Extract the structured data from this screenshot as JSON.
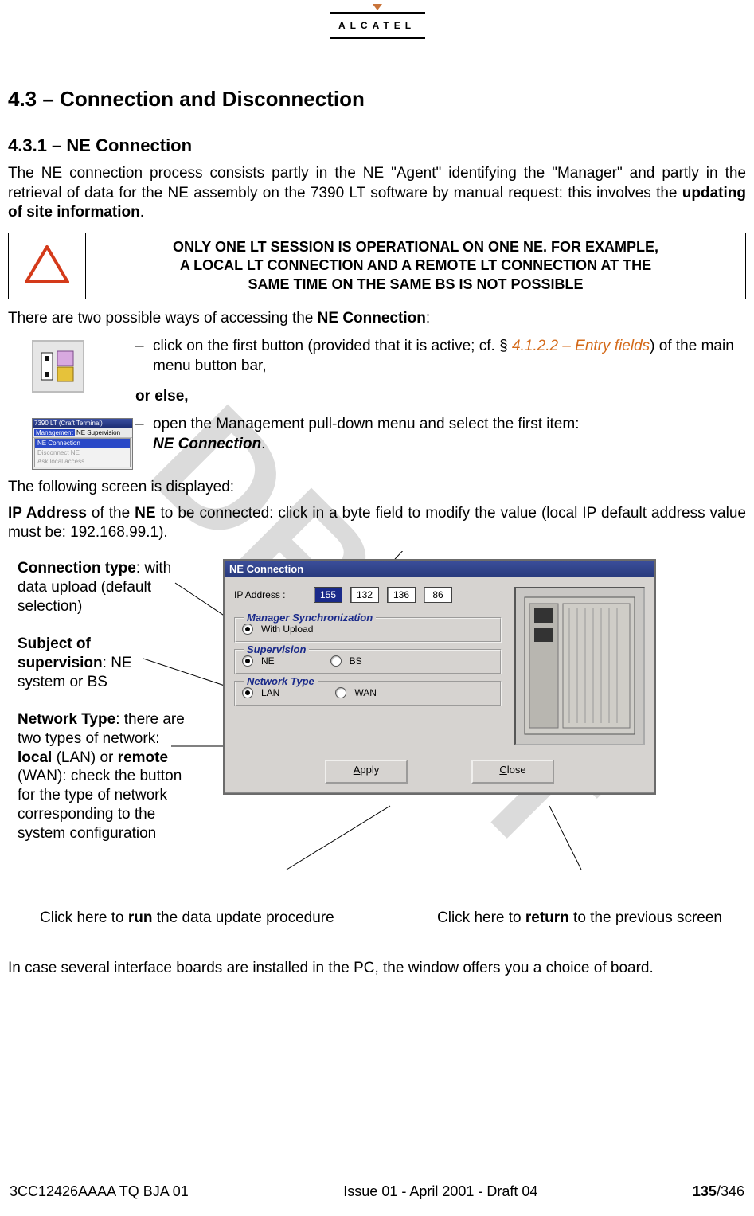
{
  "brand": "ALCATEL",
  "watermark": "DRAFT",
  "h1": "4.3 – Connection and Disconnection",
  "h2": "4.3.1 –  NE Connection",
  "p1_a": "The NE connection process consists partly in the NE \"Agent\" identifying the \"Manager\" and partly in the retrieval of data for the NE assembly on the 7390 LT software by manual request: this involves the ",
  "p1_b": "updating of site information",
  "p1_c": ".",
  "warn_l1": "ONLY ONE LT SESSION IS OPERATIONAL ON ONE NE. FOR EXAMPLE,",
  "warn_l2": "A LOCAL LT CONNECTION AND A REMOTE LT CONNECTION AT THE",
  "warn_l3": "SAME TIME ON THE SAME BS IS NOT POSSIBLE",
  "p2_a": "There are two possible ways of accessing the ",
  "p2_b": "NE Connection",
  "p2_c": ":",
  "opt1_a": "click on the first button (provided that it is active; cf. § ",
  "opt1_ref": "4.1.2.2 – Entry fields",
  "opt1_b": ") of the main menu button bar,",
  "orelse": "or else,",
  "opt2_a": "open the Management pull-down menu and select the first item: ",
  "opt2_b": "NE Connection",
  "opt2_c": ".",
  "menu_title": "7390 LT  (Craft Terminal)",
  "menu_m1": "Management",
  "menu_m2": "NE Supervision",
  "menu_item1": "NE Connection",
  "menu_item2": "Disconnect NE",
  "menu_item3": "Ask local access",
  "p3": "The following screen is displayed:",
  "p4_a": "IP Address",
  "p4_b": " of the ",
  "p4_c": "NE",
  "p4_d": " to be connected: click in a byte field to modify the value (local IP default address value must be: 192.168.99.1).",
  "call_conn_a": "Connection type",
  "call_conn_b": ": with data upload (default selection)",
  "call_sup_a": "Subject of supervision",
  "call_sup_b": ": NE system or BS",
  "call_net_a": "Network Type",
  "call_net_b": ": there are two types of network: ",
  "call_net_c": "local",
  "call_net_d": " (LAN) or ",
  "call_net_e": "remote",
  "call_net_f": " (WAN): check the button for the type of network corresponding to the system configuration",
  "ne_title": "NE Connection",
  "ne_ip_label": "IP Address :",
  "ip": [
    "155",
    "132",
    "136",
    "86"
  ],
  "grp_sync": "Manager Synchronization",
  "sync_opt": "With Upload",
  "grp_sup": "Supervision",
  "sup_ne": "NE",
  "sup_bs": "BS",
  "grp_net": "Network Type",
  "net_lan": "LAN",
  "net_wan": "WAN",
  "btn_apply": "pply",
  "btn_apply_u": "A",
  "btn_close": "lose",
  "btn_close_u": "C",
  "bottom_apply_a": "Click here to ",
  "bottom_apply_b": "run",
  "bottom_apply_c": " the data update procedure",
  "bottom_close_a": "Click here to ",
  "bottom_close_b": "return",
  "bottom_close_c": " to the previous screen",
  "p5": "In case several interface boards are installed in the PC, the window offers you a choice of board.",
  "footer_left": "3CC12426AAAA TQ BJA 01",
  "footer_center": "Issue 01 - April 2001 - Draft 04",
  "footer_page_a": "135",
  "footer_page_b": "/346"
}
